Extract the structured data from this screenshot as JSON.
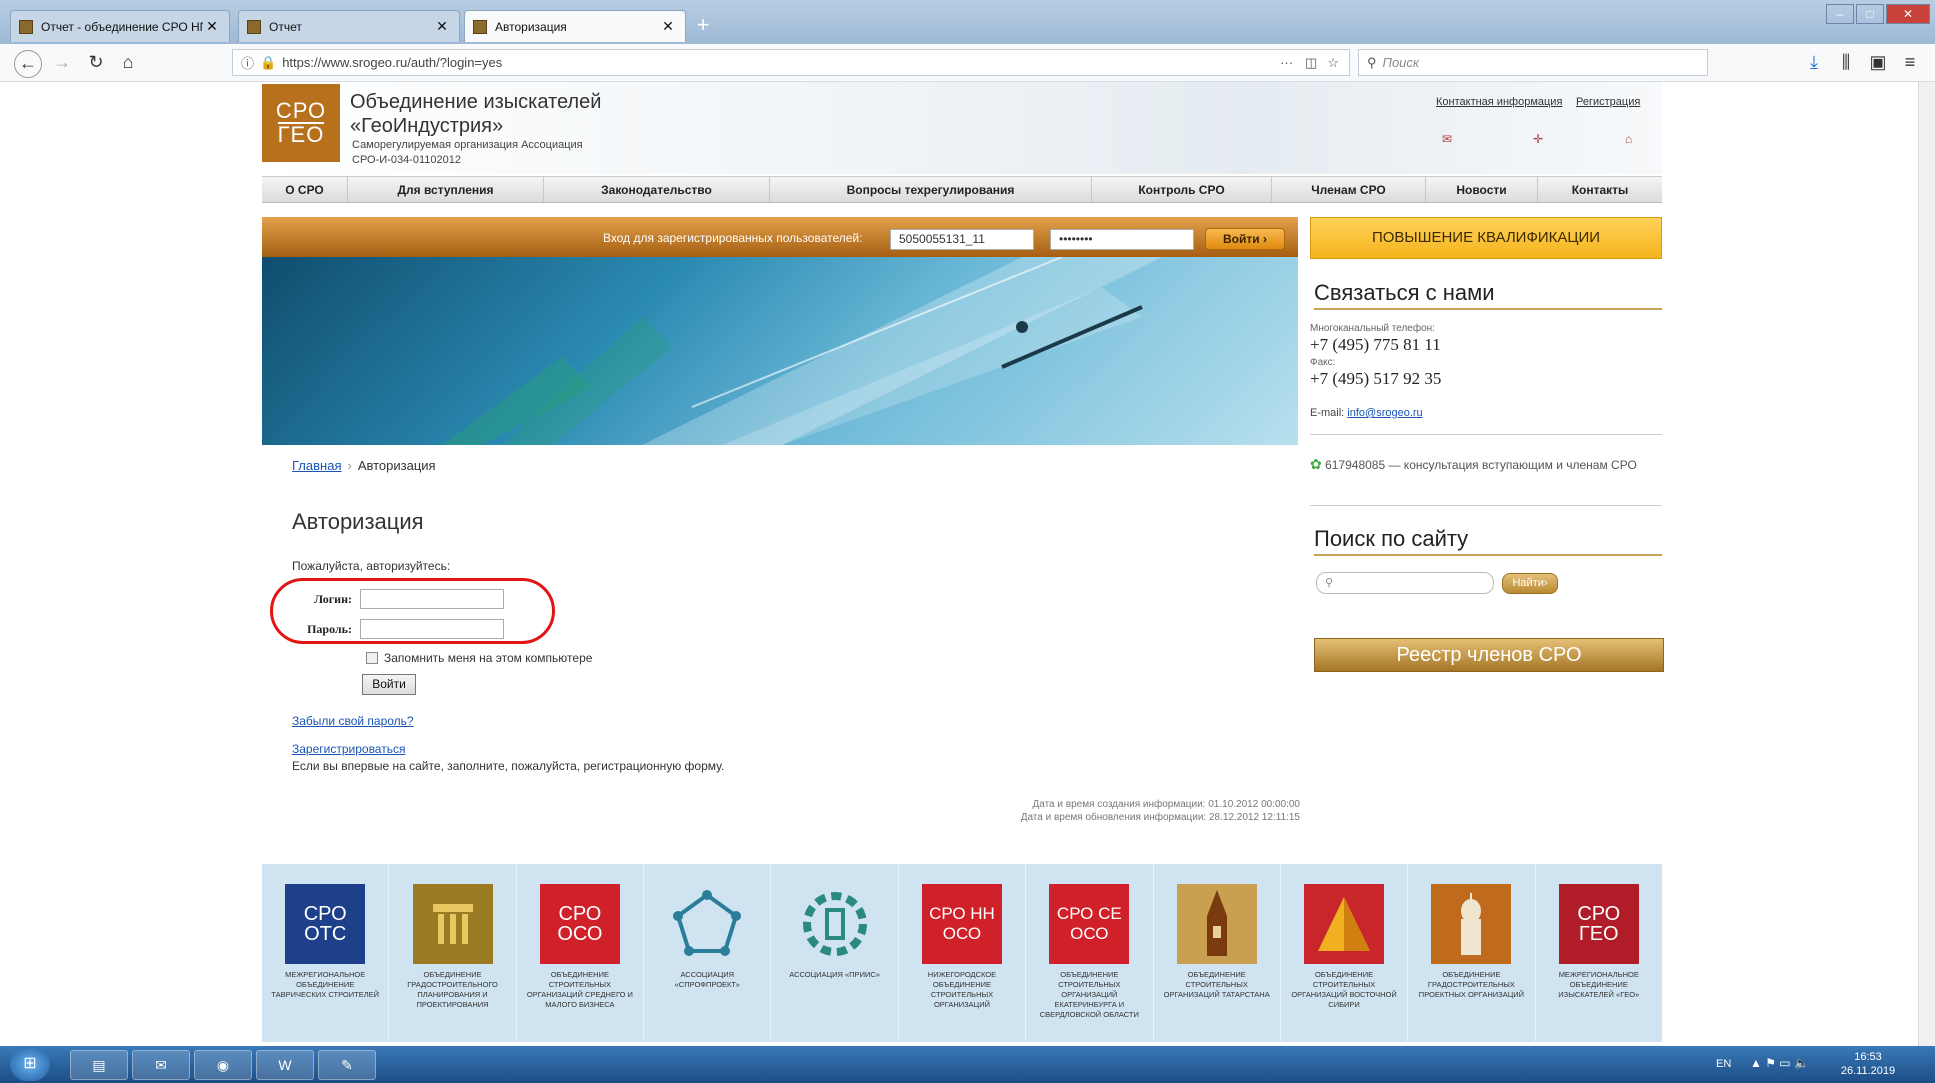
{
  "browser": {
    "tabs": [
      {
        "label": "Отчет - объединение СРО НП"
      },
      {
        "label": "Отчет"
      },
      {
        "label": "Авторизация"
      }
    ],
    "url": "https://www.srogeo.ru/auth/?login=yes",
    "search_placeholder": "Поиск"
  },
  "header": {
    "logo_line1": "СРО",
    "logo_line2": "ГЕО",
    "title_line1": "Объединение изыскателей",
    "title_line2": "«ГеоИндустрия»",
    "subtitle_line1": "Саморегулируемая организация Ассоциация",
    "subtitle_line2": "СРО-И-034-01102012",
    "link_contacts": "Контактная информация",
    "link_register": "Регистрация"
  },
  "menu": [
    {
      "label": "О СРО"
    },
    {
      "label": "Для вступления"
    },
    {
      "label": "Законодательство"
    },
    {
      "label": "Вопросы техрегулирования"
    },
    {
      "label": "Контроль СРО"
    },
    {
      "label": "Членам СРО"
    },
    {
      "label": "Новости"
    },
    {
      "label": "Контакты"
    }
  ],
  "loginbar": {
    "label": "Вход для зарегистрированных пользователей:",
    "login_value": "5050055131_11",
    "password_value": "••••••••",
    "button": "Войти"
  },
  "sidebar": {
    "qual_button": "ПОВЫШЕНИЕ КВАЛИФИКАЦИИ",
    "contact_heading": "Связаться с нами",
    "phone_label": "Многоканальный телефон:",
    "phone": "+7 (495) 775 81 11",
    "fax_label": "Факс:",
    "fax": "+7 (495) 517 92 35",
    "email_label": "E-mail:",
    "email": "info@srogeo.ru",
    "icq_text": "617948085 — консультация вступающим и членам СРО",
    "search_heading": "Поиск по сайту",
    "search_button": "Найти",
    "registry_button": "Реестр членов СРО"
  },
  "main": {
    "breadcrumb_home": "Главная",
    "breadcrumb_current": "Авторизация",
    "title": "Авторизация",
    "prompt": "Пожалуйста, авторизуйтесь:",
    "login_label": "Логин:",
    "password_label": "Пароль:",
    "remember_label": "Запомнить меня на этом компьютере",
    "submit": "Войти",
    "forgot": "Забыли свой пароль?",
    "register": "Зарегистрироваться",
    "register_text": "Если вы впервые на сайте, заполните, пожалуйста, регистрационную форму.",
    "meta_created": "Дата и время создания информации: 01.10.2012 00:00:00",
    "meta_updated": "Дата и время обновления информации: 28.12.2012 12:11:15"
  },
  "partners": [
    {
      "name": "Межрегиональное объединение таврических строителей",
      "logo": "СРО ОТС",
      "color": "#1e3f8a"
    },
    {
      "name": "Объединение градостроительного планирования и проектирования",
      "logo": "",
      "color": "#9a7a22"
    },
    {
      "name": "Объединение строительных организаций среднего и малого бизнеса",
      "logo": "СРО ОСО",
      "color": "#d0202a"
    },
    {
      "name": "Ассоциация «СПРОФПРОЕКТ»",
      "logo": "",
      "color": "#cfe3f0"
    },
    {
      "name": "Ассоциация «Приис»",
      "logo": "",
      "color": "#cfe3f0"
    },
    {
      "name": "Нижегородское объединение строительных организаций",
      "logo": "СРО НН ОСО",
      "color": "#d0202a"
    },
    {
      "name": "Объединение строительных организаций Екатеринбурга и Свердловской области",
      "logo": "СРО СЕ ОСО",
      "color": "#d0202a"
    },
    {
      "name": "Объединение строительных организаций Татарстана",
      "logo": "",
      "color": "#c8a050"
    },
    {
      "name": "Объединение строительных организаций Восточной Сибири",
      "logo": "",
      "color": "#c8262a"
    },
    {
      "name": "Объединение градостроительных проектных организаций",
      "logo": "",
      "color": "#c06a1e"
    },
    {
      "name": "Межрегиональное объединение изыскателей «Гео»",
      "logo": "СРО ГЕО",
      "color": "#b01c28"
    }
  ],
  "taskbar": {
    "lang": "EN",
    "time": "16:53",
    "date": "26.11.2019"
  }
}
